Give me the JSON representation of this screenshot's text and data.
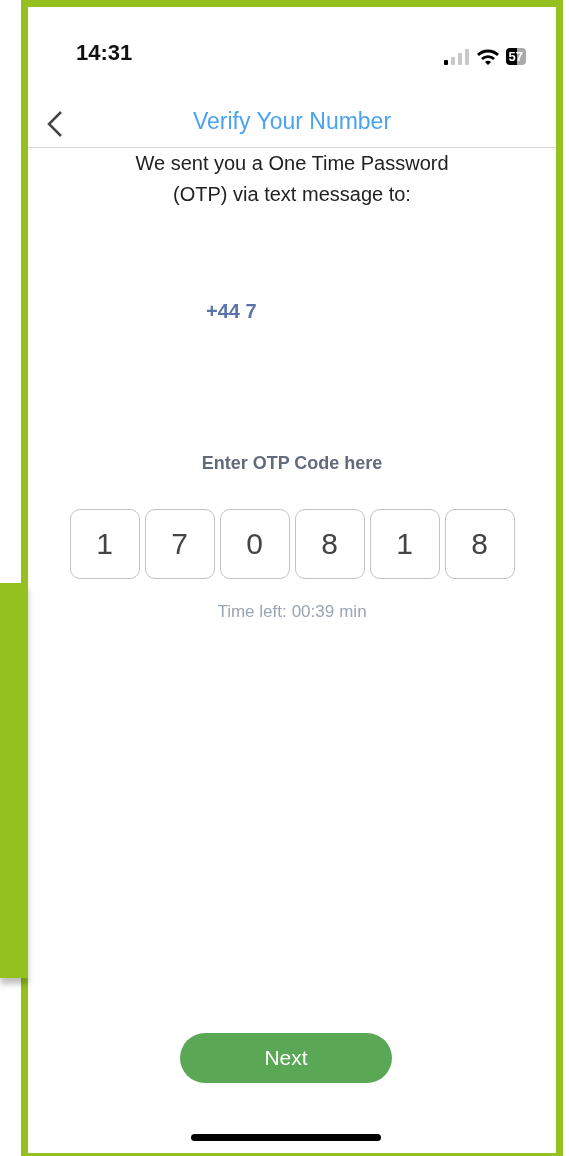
{
  "status_bar": {
    "time": "14:31",
    "battery": "57"
  },
  "header": {
    "title": "Verify Your Number"
  },
  "message": {
    "lines": [
      "We sent you a One Time Password",
      "(OTP) via text message to:"
    ]
  },
  "phone_number": "+44 7",
  "otp": {
    "label": "Enter OTP Code here",
    "digits": [
      "1",
      "7",
      "0",
      "8",
      "1",
      "8"
    ],
    "time_left_label": "Time left:",
    "time_left": "00:39",
    "time_unit": "min"
  },
  "buttons": [
    {
      "label": "Next",
      "disabled": false
    }
  ]
}
